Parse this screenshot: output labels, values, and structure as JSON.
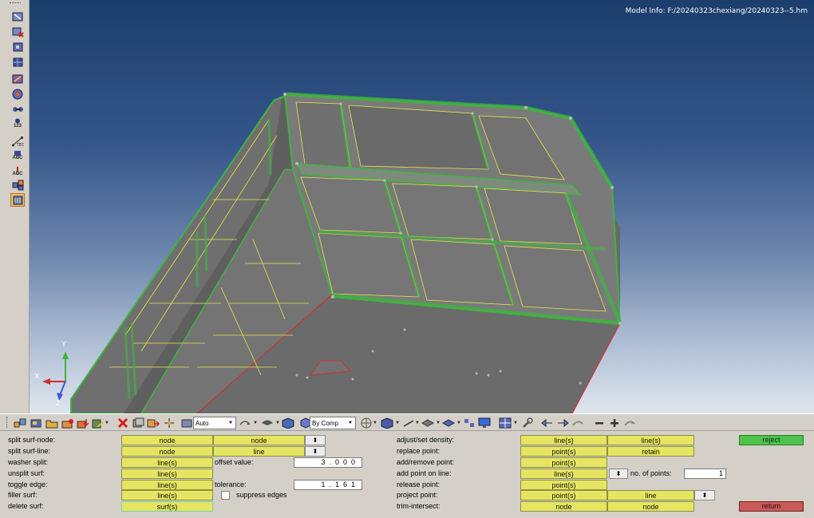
{
  "viewport": {
    "model_info": "Model Info: F:/20240323chexiang/20240323--5.hm",
    "axis_labels": {
      "x": "X",
      "y": "Y",
      "z": "Z"
    },
    "colors": {
      "bg_top": "#1c3e6c",
      "bg_bottom": "#dfe5ee",
      "surface": "#6a6a6a",
      "green_edge": "#3fb53f",
      "yellow_edge": "#e6e64a",
      "red_edge": "#d03030"
    }
  },
  "left_toolbar": {
    "icons": [
      "surface-edit-icon",
      "surface-delete-icon",
      "defeature-icon",
      "midsurface-icon",
      "dimension-icon",
      "geom-cleanup-icon",
      "connectors-icon",
      "numbers-icon",
      "distance-icon",
      "tags-icon",
      "label-icon",
      "assembly-icon",
      "quick-edit-icon"
    ],
    "text_123": "123",
    "text_abc_1": "ABC",
    "text_abc_2": "ABC"
  },
  "toolbar": {
    "display_mode": "Auto",
    "color_by": "By Comp"
  },
  "panel": {
    "left": {
      "split_surf_node": {
        "label": "split surf-node:",
        "btn1": "node",
        "btn2": "node"
      },
      "split_surf_line": {
        "label": "split surf-line:",
        "btn1": "node",
        "btn2": "line"
      },
      "washer_split": {
        "label": "washer split:",
        "btn1": "line(s)",
        "field_label": "offset value:",
        "value": "3.000"
      },
      "unsplit_surf": {
        "label": "unsplit surf:",
        "btn1": "line(s)"
      },
      "toggle_edge": {
        "label": "toggle edge:",
        "btn1": "line(s)",
        "field_label": "tolerance:",
        "value": "1.161"
      },
      "filler_surf": {
        "label": "filler surf:",
        "btn1": "line(s)",
        "checkbox_label": "suppress edges"
      },
      "delete_surf": {
        "label": "delete surf:",
        "btn1": "surf(s)"
      }
    },
    "right": {
      "adjust_density": {
        "label": "adjust/set density:",
        "btn1": "line(s)",
        "btn2": "line(s)"
      },
      "replace_point": {
        "label": "replace point:",
        "btn1": "point(s)",
        "btn2": "retain"
      },
      "add_remove_point": {
        "label": "add/remove point:",
        "btn1": "point(s)"
      },
      "add_point_on_line": {
        "label": "add point on line:",
        "btn1": "line(s)",
        "field_label": "no. of points:",
        "value": "1"
      },
      "release_point": {
        "label": "release point:",
        "btn1": "point(s)"
      },
      "project_point": {
        "label": "project point:",
        "btn1": "point(s)",
        "btn2": "line"
      },
      "trim_intersect": {
        "label": "trim-intersect:",
        "btn1": "node",
        "btn2": "node"
      }
    },
    "reject_label": "reject",
    "return_label": "return",
    "colors": {
      "button_yellow": "#e5e561",
      "reject_green": "#4cc44c",
      "return_red": "#c85a5a"
    }
  }
}
